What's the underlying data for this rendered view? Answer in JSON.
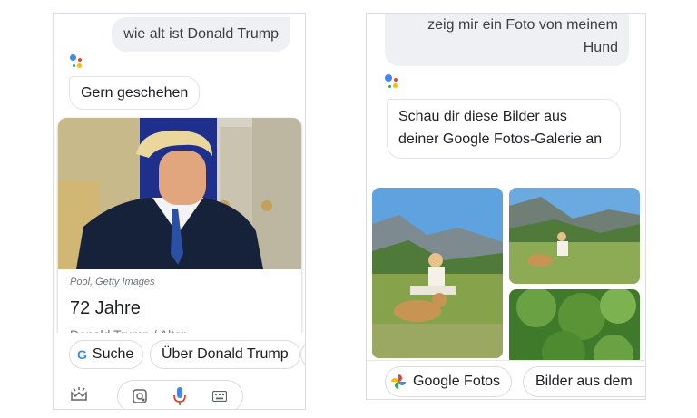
{
  "left_screen": {
    "query": "wie alt ist Donald Trump",
    "assistant_reply": "Gern geschehen",
    "card": {
      "photo_credit": "Pool, Getty Images",
      "answer": "72 Jahre",
      "subtitle": "Donald Trump / Alter"
    },
    "chips": [
      "Suche",
      "Über Donald Trump"
    ],
    "bottom_bar": {
      "icons": [
        "explore-icon",
        "lens-icon",
        "mic-icon",
        "keyboard-icon"
      ]
    }
  },
  "right_screen": {
    "query": "zeig mir ein Foto von meinem Hund",
    "assistant_reply": "Schau dir diese Bilder aus deiner Google Fotos-Galerie an",
    "chips": [
      "Google Fotos",
      "Bilder aus dem"
    ]
  },
  "colors": {
    "google_blue": "#4285f4",
    "google_red": "#ea4335",
    "google_yellow": "#fbbc05",
    "google_green": "#34a853",
    "query_bubble": "#eef0f3"
  }
}
